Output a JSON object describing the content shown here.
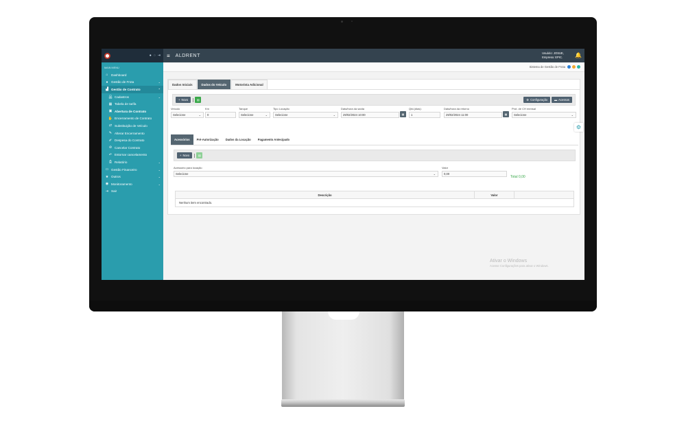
{
  "sidebar": {
    "menu_title": "MAIN MENU",
    "items": [
      {
        "label": "Dashboard",
        "icon": "home-icon",
        "glyph": "⌂",
        "chevron": ""
      },
      {
        "label": "Gestão de Frota",
        "icon": "gauge-icon",
        "glyph": "●",
        "chevron": "⌄"
      },
      {
        "label": "Gestão de Contrato",
        "icon": "chart-icon",
        "glyph": "▟",
        "chevron": "⌃"
      },
      {
        "label": "Cadastros",
        "icon": "sitemap-icon",
        "glyph": "品",
        "chevron": "⌄"
      },
      {
        "label": "Tabela de tarifa",
        "icon": "table-icon",
        "glyph": "▦",
        "chevron": ""
      },
      {
        "label": "Abertura de Contrato",
        "icon": "plus-square-icon",
        "glyph": "▣",
        "chevron": ""
      },
      {
        "label": "Encerramento de Contrato",
        "icon": "handshake-icon",
        "glyph": "✋",
        "chevron": ""
      },
      {
        "label": "Substituição de Veículo",
        "icon": "exchange-icon",
        "glyph": "⇄",
        "chevron": ""
      },
      {
        "label": "Alterar Encerramento",
        "icon": "pencil-icon",
        "glyph": "✎",
        "chevron": ""
      },
      {
        "label": "Despesa do Contrato",
        "icon": "edit-icon",
        "glyph": "✐",
        "chevron": ""
      },
      {
        "label": "Cancelar Contrato",
        "icon": "ban-icon",
        "glyph": "⊘",
        "chevron": ""
      },
      {
        "label": "Estornar cancelamento",
        "icon": "undo-icon",
        "glyph": "↶",
        "chevron": ""
      },
      {
        "label": "Relatório",
        "icon": "report-icon",
        "glyph": "⎙",
        "chevron": "⌄"
      },
      {
        "label": "Gestão Financeiro",
        "icon": "money-icon",
        "glyph": "▭",
        "chevron": "⌄"
      },
      {
        "label": "Outros",
        "icon": "star-icon",
        "glyph": "★",
        "chevron": "⌄"
      },
      {
        "label": "Monitoramento",
        "icon": "globe-icon",
        "glyph": "◉",
        "chevron": "⌄"
      },
      {
        "label": "Sair",
        "icon": "logout-icon",
        "glyph": "⇥",
        "chevron": ""
      }
    ]
  },
  "topbar": {
    "brand": "ALDRENT",
    "user_line": "Usuário: JOSUE,",
    "company_line": "Empresa: EPIC."
  },
  "subheader": {
    "system_name": "Sistema de Gestão de Frota",
    "dot_colors": [
      "#2b7fd4",
      "#f0a830",
      "#2ab5a5"
    ]
  },
  "tabs": [
    "Dados Iniciais",
    "Dados do Veículo",
    "Motorista Adicional"
  ],
  "toolbar": {
    "new_label": "Novo",
    "config_label": "Configuração",
    "access_label": "Acessos"
  },
  "fields": {
    "veiculo": {
      "label": "Veículo",
      "value": "Selecione"
    },
    "km": {
      "label": "Km",
      "value": "0"
    },
    "tanque": {
      "label": "Tanque",
      "value": "Selecione"
    },
    "tipo_locacao": {
      "label": "Tipo Locação",
      "value": "Selecione"
    },
    "data_saida": {
      "label": "Data/hora da saída",
      "value": "29/02/2024 10:00"
    },
    "qtd_dias": {
      "label": "Qtd.(dias):",
      "value": "1"
    },
    "data_retorno": {
      "label": "Data/hora da retorno",
      "value": "29/02/2024 11:00"
    },
    "prot_ch_mensal": {
      "label": "Prot. de CH mensal",
      "value": "Selecione"
    }
  },
  "subtabs": [
    "Acessórios",
    "Pré-Autorização",
    "Dados da Locação",
    "Pagamento Antecipado"
  ],
  "sub_toolbar": {
    "new_label": "Novo"
  },
  "accessory": {
    "label": "Acessório para locação",
    "value": "Selecione",
    "valor_label": "Valor",
    "valor_value": "0,00",
    "total": "Total 0,00"
  },
  "grid": {
    "columns": [
      "Descrição",
      "Valor"
    ],
    "empty_message": "Nenhum item encontrado."
  },
  "watermark": {
    "line1": "Ativar o Windows",
    "line2": "Acesse Configurações para ativar o Windows."
  }
}
